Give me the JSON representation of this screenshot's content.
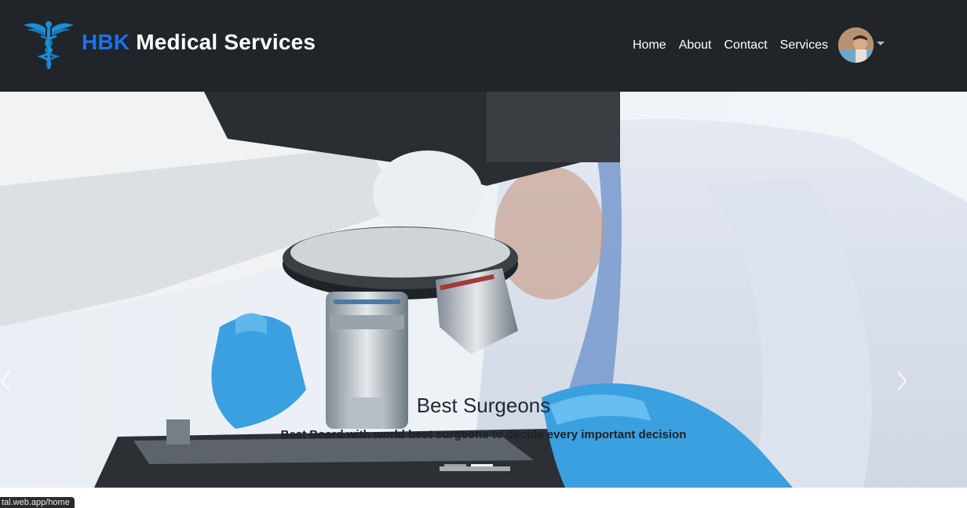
{
  "brand": {
    "accent": "HBK",
    "name": " Medical Services"
  },
  "nav": {
    "links": [
      "Home",
      "About",
      "Contact",
      "Services"
    ]
  },
  "carousel": {
    "caption_title": "Best Surgeons",
    "caption_text": "Best Board with world best surgeons to decide every important decision",
    "slides": 3,
    "active_slide": 2
  },
  "status_bar": {
    "url": "tal.web.app/home"
  },
  "colors": {
    "navbar": "#212529",
    "accent": "#1e6ff0",
    "glove": "#3aa0e0"
  }
}
